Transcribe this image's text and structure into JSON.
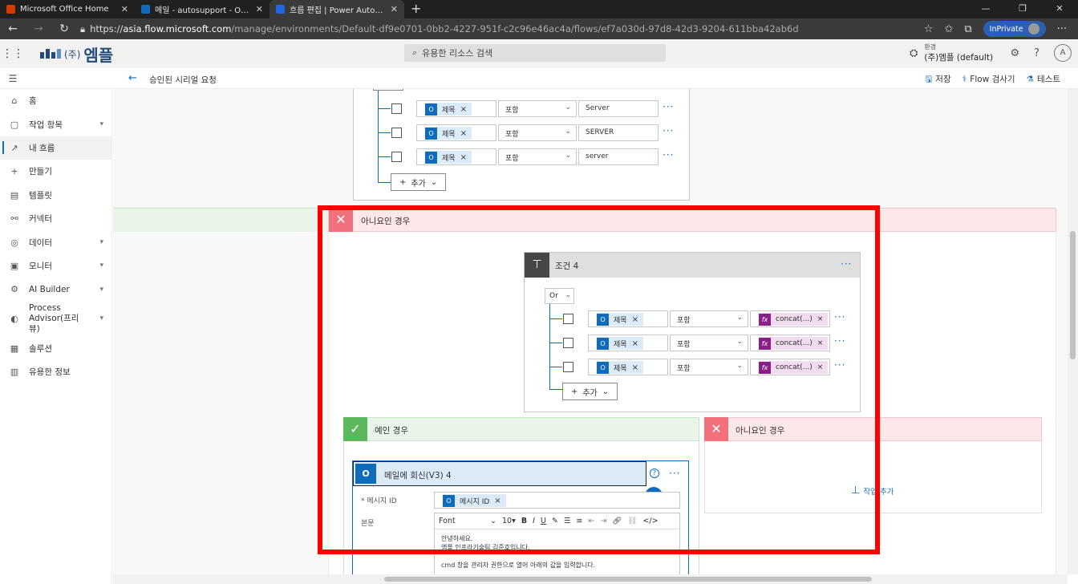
{
  "browser": {
    "tabs": [
      {
        "title": "Microsoft Office Home",
        "color": "#d83b01"
      },
      {
        "title": "메일 - autosupport - Outlook",
        "color": "#0f6cbd"
      },
      {
        "title": "흐름 편집 | Power Automate",
        "color": "#2266e3"
      }
    ],
    "new_tab": "+",
    "url_scheme": "https://",
    "url_host": "asia.flow.microsoft.com",
    "url_path": "/manage/environments/Default-df9e0701-0bb2-4227-951f-c2c96e46ac4a/flows/ef7a030d-97d8-42d3-9204-611bba42ab6d",
    "inprivate": "InPrivate"
  },
  "header": {
    "logo_paren": "(주)",
    "logo_text": "엠플",
    "search_placeholder": "유용한 리소스 검색",
    "env_label": "환경",
    "env_value": "(주)엠플 (default)",
    "account_initial": "A"
  },
  "cmdbar": {
    "flow_title": "승인된 시리얼 요청",
    "save": "저장",
    "checker": "Flow 검사기",
    "test": "테스트"
  },
  "sidenav": {
    "items": [
      {
        "icon": "home-icon",
        "glyph": "⌂",
        "label": "홈",
        "chev": false
      },
      {
        "icon": "clipboard-icon",
        "glyph": "▢",
        "label": "작업 항목",
        "chev": true
      },
      {
        "icon": "flow-icon",
        "glyph": "↗",
        "label": "내 흐름",
        "chev": false,
        "selected": true
      },
      {
        "icon": "plus-icon",
        "glyph": "+",
        "label": "만들기",
        "chev": false
      },
      {
        "icon": "template-icon",
        "glyph": "▤",
        "label": "템플릿",
        "chev": false
      },
      {
        "icon": "connector-icon",
        "glyph": "⚯",
        "label": "커넥터",
        "chev": false
      },
      {
        "icon": "data-icon",
        "glyph": "◎",
        "label": "데이터",
        "chev": true
      },
      {
        "icon": "monitor-icon",
        "glyph": "▣",
        "label": "모니터",
        "chev": true
      },
      {
        "icon": "ai-builder-icon",
        "glyph": "⚙",
        "label": "AI Builder",
        "chev": true
      },
      {
        "icon": "process-advisor-icon",
        "glyph": "◐",
        "label": "Process Advisor(프리뷰)",
        "chev": true,
        "tall": true
      },
      {
        "icon": "solutions-icon",
        "glyph": "▦",
        "label": "솔루션",
        "chev": false
      },
      {
        "icon": "learn-icon",
        "glyph": "▥",
        "label": "유용한 정보",
        "chev": false
      }
    ]
  },
  "top_condition": {
    "rows": [
      {
        "token": "제목",
        "operator": "포함",
        "value": "Server"
      },
      {
        "token": "제목",
        "operator": "포함",
        "value": "SERVER"
      },
      {
        "token": "제목",
        "operator": "포함",
        "value": "server"
      }
    ],
    "add_label": "추가"
  },
  "outer_no_branch": {
    "label": "아니요인 경우"
  },
  "condition4": {
    "title": "조건 4",
    "group": "Or",
    "rows": [
      {
        "token": "제목",
        "operator": "포함",
        "expr": "concat(...)"
      },
      {
        "token": "제목",
        "operator": "포함",
        "expr": "concat(...)"
      },
      {
        "token": "제목",
        "operator": "포함",
        "expr": "concat(...)"
      }
    ],
    "add_label": "추가"
  },
  "yes_branch": {
    "label": "예인 경우"
  },
  "no_branch": {
    "label": "아니요인 경우",
    "add_action": "작업 추가"
  },
  "reply_action": {
    "title": "메일에 회신(V3) 4",
    "message_id_label": "* 메시지 ID",
    "message_id_token": "메시지 ID",
    "body_label": "본문",
    "font": "Font",
    "font_size": "10",
    "body_line1": "안녕하세요.",
    "body_line2": "엠플 인프라기술팀 김준호입니다.",
    "body_line3": "cmd 창을 관리자 권한으로 열어 아래의 값을 입력합니다."
  },
  "colors": {
    "accent": "#0f6cbd",
    "yes_band": "#e9f5e9",
    "yes_icon": "#5cb85c",
    "no_band": "#fde7e9",
    "no_icon": "#f1707b",
    "highlight": "#ff0000",
    "condition_header": "#e1dfdd"
  }
}
